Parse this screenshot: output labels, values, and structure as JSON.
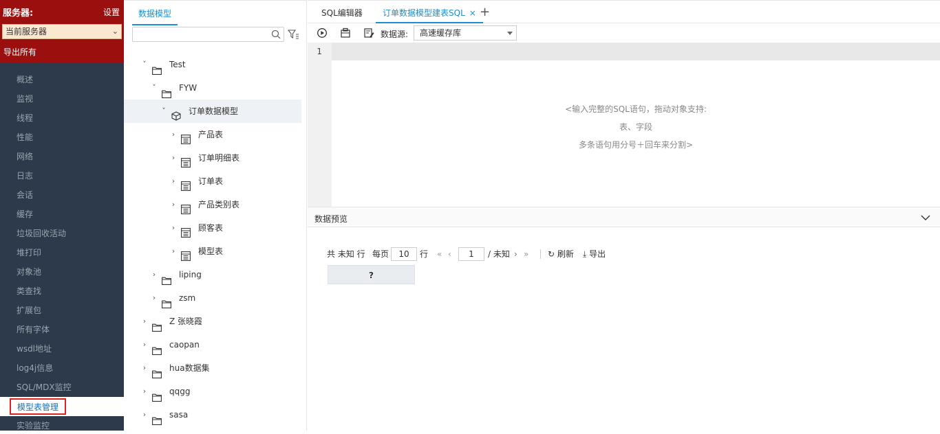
{
  "server": {
    "title": "服务器:",
    "settings_label": "设置",
    "current_server": "当前服务器",
    "export_all": "导出所有"
  },
  "nav": {
    "items": [
      "概述",
      "监视",
      "线程",
      "性能",
      "网络",
      "日志",
      "会话",
      "缓存",
      "垃圾回收活动",
      "堆打印",
      "对象池",
      "类查找",
      "扩展包",
      "所有字体",
      "wsdl地址",
      "log4j信息",
      "SQL/MDX监控",
      "模型表管理",
      "实验监控"
    ],
    "active": "模型表管理"
  },
  "tree": {
    "tab_label": "数据模型",
    "search_placeholder": "",
    "nodes": [
      {
        "label": "Test",
        "type": "folder",
        "expanded": true
      },
      {
        "label": "FYW",
        "type": "folder",
        "expanded": true
      },
      {
        "label": "订单数据模型",
        "type": "model",
        "expanded": true,
        "selected": true
      },
      {
        "label": "产品表",
        "type": "table"
      },
      {
        "label": "订单明细表",
        "type": "table"
      },
      {
        "label": "订单表",
        "type": "table"
      },
      {
        "label": "产品类别表",
        "type": "table"
      },
      {
        "label": "顾客表",
        "type": "table"
      },
      {
        "label": "模型表",
        "type": "table"
      },
      {
        "label": "liping",
        "type": "folder"
      },
      {
        "label": "zsm",
        "type": "folder"
      },
      {
        "label": "Z 张晓霞",
        "type": "folder"
      },
      {
        "label": "caopan",
        "type": "folder"
      },
      {
        "label": "hua数据集",
        "type": "folder"
      },
      {
        "label": "qqgg",
        "type": "folder"
      },
      {
        "label": "sasa",
        "type": "folder"
      }
    ]
  },
  "editor": {
    "tabs": [
      "SQL编辑器",
      "订单数据模型建表SQL"
    ],
    "close_symbol": "×",
    "add_symbol": "+",
    "datasource_label": "数据源:",
    "datasource_value": "高速缓存库",
    "line_number": "1",
    "hint_lines": [
      "<输入完整的SQL语句，拖动对象支持:",
      "表、字段",
      "多条语句用分号＋回车来分割>"
    ]
  },
  "preview": {
    "title": "数据预览",
    "total_label": "共 未知 行",
    "per_page_label": "每页",
    "per_page_value": "10",
    "row_unit": "行",
    "page_value": "1",
    "page_total": "/ 未知",
    "refresh_label": "刷新",
    "export_label": "导出",
    "column_header": "?"
  },
  "colors": {
    "accent": "#1a8fd1",
    "server_header": "#9b0f0f",
    "sidebar_bg": "#2d3a4b"
  }
}
